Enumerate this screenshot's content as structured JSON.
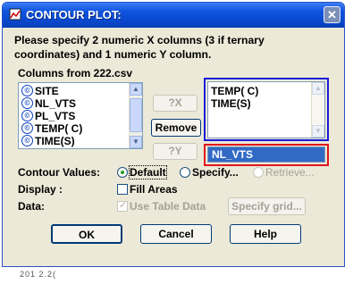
{
  "window": {
    "title": "CONTOUR PLOT:",
    "close_label": "✕"
  },
  "instructions": {
    "line1": "Please specify 2 numeric X columns (3 if ternary",
    "line2": "coordinates) and 1 numeric Y column."
  },
  "columns": {
    "label": "Columns from 222.csv",
    "type_glyph": "©",
    "items": [
      "SITE",
      "NL_VTS",
      "PL_VTS",
      "TEMP( C)",
      "TIME(S)"
    ]
  },
  "buttons": {
    "x_add": "?X",
    "remove": "Remove",
    "y_add": "?Y",
    "ok": "OK",
    "cancel": "Cancel",
    "help": "Help",
    "specify_grid": "Specify grid..."
  },
  "x_columns": [
    "TEMP( C)",
    "TIME(S)"
  ],
  "y_column": "NL_VTS",
  "contour_values": {
    "label": "Contour Values:",
    "options": [
      {
        "label": "Default",
        "checked": true,
        "enabled": true
      },
      {
        "label": "Specify...",
        "checked": false,
        "enabled": true
      },
      {
        "label": "Retrieve...",
        "checked": false,
        "enabled": false
      }
    ]
  },
  "display": {
    "label": "Display :",
    "fill_areas": "Fill Areas",
    "fill_areas_checked": false
  },
  "data_section": {
    "label": "Data:",
    "use_table_data": "Use Table Data",
    "use_table_data_checked": true
  },
  "background_text": "201   2.2(",
  "colors": {
    "titlebar": "#0a49d0",
    "dialog_bg": "#ece9d8",
    "selection": "#316ac5",
    "highlight_x": "#1a1ad6",
    "highlight_y": "#e0141b"
  }
}
